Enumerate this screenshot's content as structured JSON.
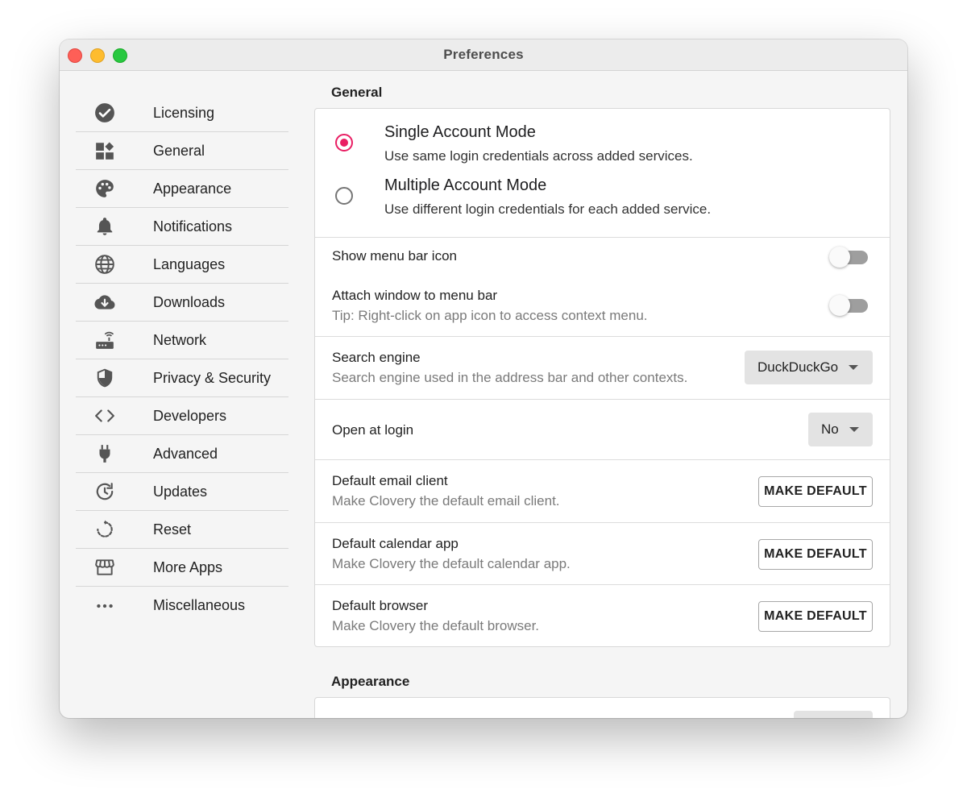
{
  "window": {
    "title": "Preferences"
  },
  "sidebar": {
    "items": [
      {
        "label": "Licensing",
        "icon": "check-circle-icon"
      },
      {
        "label": "General",
        "icon": "dashboard-icon"
      },
      {
        "label": "Appearance",
        "icon": "palette-icon"
      },
      {
        "label": "Notifications",
        "icon": "bell-icon"
      },
      {
        "label": "Languages",
        "icon": "globe-icon"
      },
      {
        "label": "Downloads",
        "icon": "cloud-download-icon"
      },
      {
        "label": "Network",
        "icon": "router-icon"
      },
      {
        "label": "Privacy & Security",
        "icon": "shield-icon"
      },
      {
        "label": "Developers",
        "icon": "code-icon"
      },
      {
        "label": "Advanced",
        "icon": "plug-icon"
      },
      {
        "label": "Updates",
        "icon": "update-icon"
      },
      {
        "label": "Reset",
        "icon": "reset-icon"
      },
      {
        "label": "More Apps",
        "icon": "store-icon"
      },
      {
        "label": "Miscellaneous",
        "icon": "more-horizontal-icon"
      }
    ]
  },
  "general": {
    "section_title": "General",
    "account_mode": {
      "selected": "single",
      "single": {
        "title": "Single Account Mode",
        "desc": "Use same login credentials across added services."
      },
      "multiple": {
        "title": "Multiple Account Mode",
        "desc": "Use different login credentials for each added service."
      }
    },
    "show_menu_bar_icon": {
      "title": "Show menu bar icon",
      "enabled": false
    },
    "attach_window": {
      "title": "Attach window to menu bar",
      "desc": "Tip: Right-click on app icon to access context menu.",
      "enabled": false
    },
    "search_engine": {
      "title": "Search engine",
      "desc": "Search engine used in the address bar and other contexts.",
      "value": "DuckDuckGo"
    },
    "open_at_login": {
      "title": "Open at login",
      "value": "No"
    },
    "default_email": {
      "title": "Default email client",
      "desc": "Make Clovery the default email client.",
      "button": "MAKE DEFAULT"
    },
    "default_calendar": {
      "title": "Default calendar app",
      "desc": "Make Clovery the default calendar app.",
      "button": "MAKE DEFAULT"
    },
    "default_browser": {
      "title": "Default browser",
      "desc": "Make Clovery the default browser.",
      "button": "MAKE DEFAULT"
    }
  },
  "appearance": {
    "section_title": "Appearance"
  },
  "colors": {
    "accent": "#e91e63",
    "toggle_off_track": "#9e9e9e",
    "traffic_close": "#fe5f57",
    "traffic_min": "#febc2e",
    "traffic_max": "#28c840"
  }
}
